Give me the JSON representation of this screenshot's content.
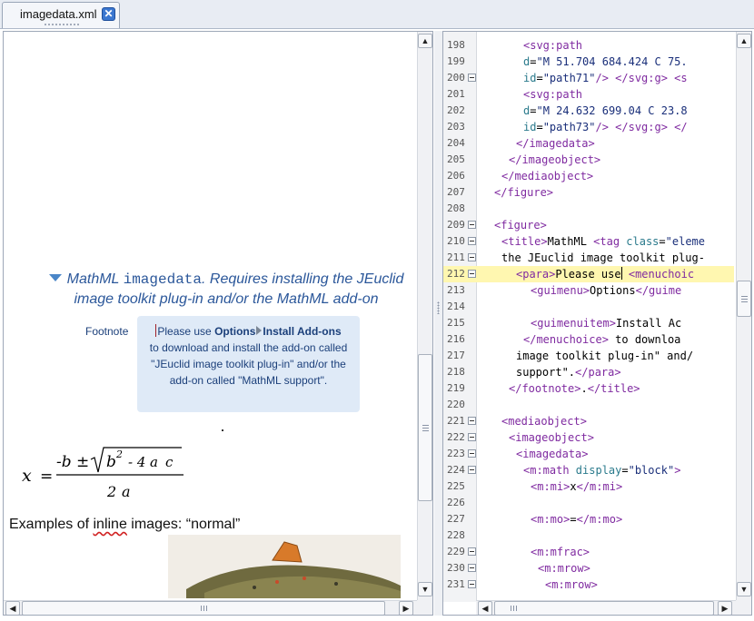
{
  "tab": {
    "title": "imagedata.xml",
    "close_icon": "close-icon"
  },
  "left": {
    "fig_title_prefix": "MathML ",
    "fig_title_code": "imagedata",
    "fig_title_suffix": ". Requires installing the JEuclid image toolkit plug-in and/or the MathML add-on",
    "footnote_label": "Footnote",
    "footnote": {
      "t1": "Please use ",
      "b1": "Options",
      "b2": "Install Add-ons",
      "t2": "to download and install the add-on called \"JEuclid image toolkit plug-in\" and/or the add-on called \"MathML support\"."
    },
    "formula": {
      "x": "x",
      "eq": "=",
      "numer_start": "-b ±",
      "b": "b",
      "exp": "2",
      "rest": "- 4",
      "a": "a",
      "c": "c",
      "denom_two": "2",
      "denom_a": "a"
    },
    "inline_text_pre": "Examples of ",
    "inline_text_squiggle": "inline",
    "inline_text_post": " images: “normal”"
  },
  "editor": {
    "lines": [
      {
        "n": "198",
        "fold": false,
        "hl": false,
        "indent": 6,
        "parts": [
          [
            "t-tag",
            "<svg:path"
          ]
        ]
      },
      {
        "n": "199",
        "fold": false,
        "hl": false,
        "indent": 6,
        "parts": [
          [
            "t-attr",
            "d"
          ],
          [
            "t-text",
            "="
          ],
          [
            "t-val",
            "\"M 51.704 684.424 C 75."
          ]
        ]
      },
      {
        "n": "200",
        "fold": true,
        "hl": false,
        "indent": 6,
        "parts": [
          [
            "t-attr",
            "id"
          ],
          [
            "t-text",
            "="
          ],
          [
            "t-val",
            "\"path71\""
          ],
          [
            "t-tag",
            "/> </svg:g> <s"
          ]
        ]
      },
      {
        "n": "201",
        "fold": false,
        "hl": false,
        "indent": 6,
        "parts": [
          [
            "t-tag",
            "<svg:path"
          ]
        ]
      },
      {
        "n": "202",
        "fold": false,
        "hl": false,
        "indent": 6,
        "parts": [
          [
            "t-attr",
            "d"
          ],
          [
            "t-text",
            "="
          ],
          [
            "t-val",
            "\"M 24.632 699.04 C 23.8"
          ]
        ]
      },
      {
        "n": "203",
        "fold": false,
        "hl": false,
        "indent": 6,
        "parts": [
          [
            "t-attr",
            "id"
          ],
          [
            "t-text",
            "="
          ],
          [
            "t-val",
            "\"path73\""
          ],
          [
            "t-tag",
            "/> </svg:g> </"
          ]
        ]
      },
      {
        "n": "204",
        "fold": false,
        "hl": false,
        "indent": 5,
        "parts": [
          [
            "t-tag",
            "</imagedata>"
          ]
        ]
      },
      {
        "n": "205",
        "fold": false,
        "hl": false,
        "indent": 4,
        "parts": [
          [
            "t-tag",
            "</imageobject>"
          ]
        ]
      },
      {
        "n": "206",
        "fold": false,
        "hl": false,
        "indent": 3,
        "parts": [
          [
            "t-tag",
            "</mediaobject>"
          ]
        ]
      },
      {
        "n": "207",
        "fold": false,
        "hl": false,
        "indent": 2,
        "parts": [
          [
            "t-tag",
            "</figure>"
          ]
        ]
      },
      {
        "n": "208",
        "fold": false,
        "hl": false,
        "indent": 0,
        "parts": []
      },
      {
        "n": "209",
        "fold": true,
        "hl": false,
        "indent": 2,
        "parts": [
          [
            "t-tag",
            "<figure>"
          ]
        ]
      },
      {
        "n": "210",
        "fold": true,
        "hl": false,
        "indent": 3,
        "parts": [
          [
            "t-tag",
            "<title>"
          ],
          [
            "t-text",
            "MathML "
          ],
          [
            "t-tag",
            "<tag "
          ],
          [
            "t-attr",
            "class"
          ],
          [
            "t-text",
            "="
          ],
          [
            "t-val",
            "\"eleme"
          ]
        ]
      },
      {
        "n": "211",
        "fold": true,
        "hl": false,
        "indent": 3,
        "parts": [
          [
            "t-text",
            "the JEuclid image toolkit plug-"
          ]
        ]
      },
      {
        "n": "212",
        "fold": true,
        "hl": true,
        "indent": 5,
        "parts": [
          [
            "t-tag",
            "<para>"
          ],
          [
            "t-text",
            "Please use"
          ],
          [
            "cursor",
            ""
          ],
          [
            "t-text",
            " "
          ],
          [
            "t-tag",
            "<menuchoic"
          ]
        ]
      },
      {
        "n": "213",
        "fold": false,
        "hl": false,
        "indent": 7,
        "parts": [
          [
            "t-tag",
            "<guimenu>"
          ],
          [
            "t-text",
            "Options"
          ],
          [
            "t-tag",
            "</guime"
          ]
        ]
      },
      {
        "n": "214",
        "fold": false,
        "hl": false,
        "indent": 0,
        "parts": []
      },
      {
        "n": "215",
        "fold": false,
        "hl": false,
        "indent": 7,
        "parts": [
          [
            "t-tag",
            "<guimenuitem>"
          ],
          [
            "t-text",
            "Install Ac"
          ]
        ]
      },
      {
        "n": "216",
        "fold": false,
        "hl": false,
        "indent": 6,
        "parts": [
          [
            "t-tag",
            "</menuchoice>"
          ],
          [
            "t-text",
            " to downloa"
          ]
        ]
      },
      {
        "n": "217",
        "fold": false,
        "hl": false,
        "indent": 5,
        "parts": [
          [
            "t-text",
            "image toolkit plug-in\" and/"
          ]
        ]
      },
      {
        "n": "218",
        "fold": false,
        "hl": false,
        "indent": 5,
        "parts": [
          [
            "t-text",
            "support\"."
          ],
          [
            "t-tag",
            "</para>"
          ]
        ]
      },
      {
        "n": "219",
        "fold": false,
        "hl": false,
        "indent": 4,
        "parts": [
          [
            "t-tag",
            "</footnote>"
          ],
          [
            "t-text",
            "."
          ],
          [
            "t-tag",
            "</title>"
          ]
        ]
      },
      {
        "n": "220",
        "fold": false,
        "hl": false,
        "indent": 0,
        "parts": []
      },
      {
        "n": "221",
        "fold": true,
        "hl": false,
        "indent": 3,
        "parts": [
          [
            "t-tag",
            "<mediaobject>"
          ]
        ]
      },
      {
        "n": "222",
        "fold": true,
        "hl": false,
        "indent": 4,
        "parts": [
          [
            "t-tag",
            "<imageobject>"
          ]
        ]
      },
      {
        "n": "223",
        "fold": true,
        "hl": false,
        "indent": 5,
        "parts": [
          [
            "t-tag",
            "<imagedata>"
          ]
        ]
      },
      {
        "n": "224",
        "fold": true,
        "hl": false,
        "indent": 6,
        "parts": [
          [
            "t-tag",
            "<m:math "
          ],
          [
            "t-attr",
            "display"
          ],
          [
            "t-text",
            "="
          ],
          [
            "t-val",
            "\"block\""
          ],
          [
            "t-tag",
            ">"
          ]
        ]
      },
      {
        "n": "225",
        "fold": false,
        "hl": false,
        "indent": 7,
        "parts": [
          [
            "t-tag",
            "<m:mi>"
          ],
          [
            "t-text",
            "x"
          ],
          [
            "t-tag",
            "</m:mi>"
          ]
        ]
      },
      {
        "n": "226",
        "fold": false,
        "hl": false,
        "indent": 0,
        "parts": []
      },
      {
        "n": "227",
        "fold": false,
        "hl": false,
        "indent": 7,
        "parts": [
          [
            "t-tag",
            "<m:mo>"
          ],
          [
            "t-text",
            "="
          ],
          [
            "t-tag",
            "</m:mo>"
          ]
        ]
      },
      {
        "n": "228",
        "fold": false,
        "hl": false,
        "indent": 0,
        "parts": []
      },
      {
        "n": "229",
        "fold": true,
        "hl": false,
        "indent": 7,
        "parts": [
          [
            "t-tag",
            "<m:mfrac>"
          ]
        ]
      },
      {
        "n": "230",
        "fold": true,
        "hl": false,
        "indent": 8,
        "parts": [
          [
            "t-tag",
            "<m:mrow>"
          ]
        ]
      },
      {
        "n": "231",
        "fold": true,
        "hl": false,
        "indent": 9,
        "parts": [
          [
            "t-tag",
            "<m:mrow>"
          ]
        ]
      }
    ]
  },
  "colors": {
    "accent": "#2b579a",
    "tag": "#7f2aa0",
    "attr": "#2a7a8c",
    "value": "#1a2f7a",
    "highlight": "#fff7b0"
  }
}
